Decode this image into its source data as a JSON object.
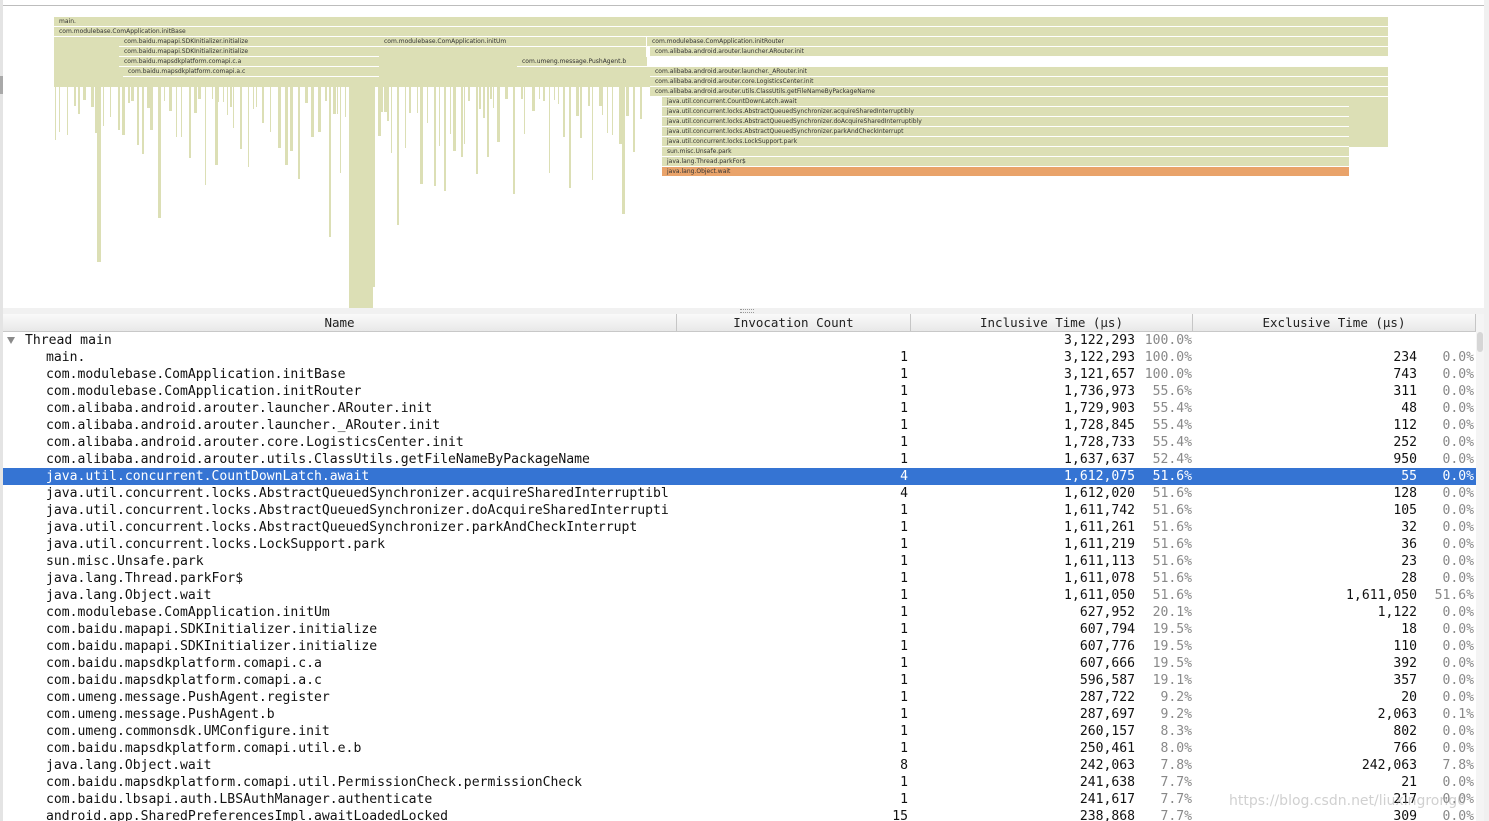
{
  "flame": {
    "bars": [
      {
        "label": "main.",
        "hot": false
      },
      {
        "label": "com.modulebase.ComApplication.initBase",
        "hot": false
      },
      {
        "label": "com.baidu.mapapi.SDKInitializer.initialize",
        "hot": false
      },
      {
        "label": "com.modulebase.ComApplication.initUm",
        "hot": false
      },
      {
        "label": "com.modulebase.ComApplication.initRouter",
        "hot": false
      },
      {
        "label": "com.baidu.mapapi.SDKInitializer.initialize",
        "hot": false
      },
      {
        "label": "com.alibaba.android.arouter.launcher.ARouter.init",
        "hot": false
      },
      {
        "label": "com.baidu.mapsdkplatform.comapi.c.a",
        "hot": false
      },
      {
        "label": "com.umeng.message.PushAgent.b",
        "hot": false
      },
      {
        "label": "com.alibaba.android.arouter.launcher._ARouter.init",
        "hot": false
      },
      {
        "label": "com.baidu.mapsdkplatform.comapi.a.c",
        "hot": false
      },
      {
        "label": "com.alibaba.android.arouter.core.LogisticsCenter.init",
        "hot": false
      },
      {
        "label": "com.alibaba.android.arouter.utils.ClassUtils.getFileNameByPackageName",
        "hot": false
      },
      {
        "label": "java.util.concurrent.CountDownLatch.await",
        "hot": false
      },
      {
        "label": "java.util.concurrent.locks.AbstractQueuedSynchronizer.acquireSharedInterruptibly",
        "hot": false
      },
      {
        "label": "java.util.concurrent.locks.AbstractQueuedSynchronizer.doAcquireSharedInterruptibly",
        "hot": false
      },
      {
        "label": "java.util.concurrent.locks.AbstractQueuedSynchronizer.parkAndCheckInterrupt",
        "hot": false
      },
      {
        "label": "java.util.concurrent.locks.LockSupport.park",
        "hot": false
      },
      {
        "label": "sun.misc.Unsafe.park",
        "hot": false
      },
      {
        "label": "java.lang.Thread.parkFor$",
        "hot": false
      },
      {
        "label": "java.lang.Object.wait",
        "hot": true
      }
    ]
  },
  "table": {
    "headers": {
      "name": "Name",
      "invocation": "Invocation Count",
      "inclusive": "Inclusive Time (µs)",
      "exclusive": "Exclusive Time (µs)"
    },
    "thread_row": {
      "name": "Thread main",
      "inclusive": "3,122,293",
      "inclusive_pct": "100.0%"
    },
    "rows": [
      {
        "name": "main.",
        "count": "1",
        "incl": "3,122,293",
        "inclp": "100.0%",
        "excl": "234",
        "exclp": "0.0%"
      },
      {
        "name": "com.modulebase.ComApplication.initBase",
        "count": "1",
        "incl": "3,121,657",
        "inclp": "100.0%",
        "excl": "743",
        "exclp": "0.0%"
      },
      {
        "name": "com.modulebase.ComApplication.initRouter",
        "count": "1",
        "incl": "1,736,973",
        "inclp": "55.6%",
        "excl": "311",
        "exclp": "0.0%"
      },
      {
        "name": "com.alibaba.android.arouter.launcher.ARouter.init",
        "count": "1",
        "incl": "1,729,903",
        "inclp": "55.4%",
        "excl": "48",
        "exclp": "0.0%"
      },
      {
        "name": "com.alibaba.android.arouter.launcher._ARouter.init",
        "count": "1",
        "incl": "1,728,845",
        "inclp": "55.4%",
        "excl": "112",
        "exclp": "0.0%"
      },
      {
        "name": "com.alibaba.android.arouter.core.LogisticsCenter.init",
        "count": "1",
        "incl": "1,728,733",
        "inclp": "55.4%",
        "excl": "252",
        "exclp": "0.0%"
      },
      {
        "name": "com.alibaba.android.arouter.utils.ClassUtils.getFileNameByPackageName",
        "count": "1",
        "incl": "1,637,637",
        "inclp": "52.4%",
        "excl": "950",
        "exclp": "0.0%"
      },
      {
        "name": "java.util.concurrent.CountDownLatch.await",
        "count": "4",
        "incl": "1,612,075",
        "inclp": "51.6%",
        "excl": "55",
        "exclp": "0.0%",
        "selected": true
      },
      {
        "name": "java.util.concurrent.locks.AbstractQueuedSynchronizer.acquireSharedInterruptibl",
        "count": "4",
        "incl": "1,612,020",
        "inclp": "51.6%",
        "excl": "128",
        "exclp": "0.0%"
      },
      {
        "name": "java.util.concurrent.locks.AbstractQueuedSynchronizer.doAcquireSharedInterrupti",
        "count": "1",
        "incl": "1,611,742",
        "inclp": "51.6%",
        "excl": "105",
        "exclp": "0.0%"
      },
      {
        "name": "java.util.concurrent.locks.AbstractQueuedSynchronizer.parkAndCheckInterrupt",
        "count": "1",
        "incl": "1,611,261",
        "inclp": "51.6%",
        "excl": "32",
        "exclp": "0.0%"
      },
      {
        "name": "java.util.concurrent.locks.LockSupport.park",
        "count": "1",
        "incl": "1,611,219",
        "inclp": "51.6%",
        "excl": "36",
        "exclp": "0.0%"
      },
      {
        "name": "sun.misc.Unsafe.park",
        "count": "1",
        "incl": "1,611,113",
        "inclp": "51.6%",
        "excl": "23",
        "exclp": "0.0%"
      },
      {
        "name": "java.lang.Thread.parkFor$",
        "count": "1",
        "incl": "1,611,078",
        "inclp": "51.6%",
        "excl": "28",
        "exclp": "0.0%"
      },
      {
        "name": "java.lang.Object.wait",
        "count": "1",
        "incl": "1,611,050",
        "inclp": "51.6%",
        "excl": "1,611,050",
        "exclp": "51.6%"
      },
      {
        "name": "com.modulebase.ComApplication.initUm",
        "count": "1",
        "incl": "627,952",
        "inclp": "20.1%",
        "excl": "1,122",
        "exclp": "0.0%"
      },
      {
        "name": "com.baidu.mapapi.SDKInitializer.initialize",
        "count": "1",
        "incl": "607,794",
        "inclp": "19.5%",
        "excl": "18",
        "exclp": "0.0%"
      },
      {
        "name": "com.baidu.mapapi.SDKInitializer.initialize",
        "count": "1",
        "incl": "607,776",
        "inclp": "19.5%",
        "excl": "110",
        "exclp": "0.0%"
      },
      {
        "name": "com.baidu.mapsdkplatform.comapi.c.a",
        "count": "1",
        "incl": "607,666",
        "inclp": "19.5%",
        "excl": "392",
        "exclp": "0.0%"
      },
      {
        "name": "com.baidu.mapsdkplatform.comapi.a.c",
        "count": "1",
        "incl": "596,587",
        "inclp": "19.1%",
        "excl": "357",
        "exclp": "0.0%"
      },
      {
        "name": "com.umeng.message.PushAgent.register",
        "count": "1",
        "incl": "287,722",
        "inclp": "9.2%",
        "excl": "20",
        "exclp": "0.0%"
      },
      {
        "name": "com.umeng.message.PushAgent.b",
        "count": "1",
        "incl": "287,697",
        "inclp": "9.2%",
        "excl": "2,063",
        "exclp": "0.1%"
      },
      {
        "name": "com.umeng.commonsdk.UMConfigure.init",
        "count": "1",
        "incl": "260,157",
        "inclp": "8.3%",
        "excl": "802",
        "exclp": "0.0%"
      },
      {
        "name": "com.baidu.mapsdkplatform.comapi.util.e.b",
        "count": "1",
        "incl": "250,461",
        "inclp": "8.0%",
        "excl": "766",
        "exclp": "0.0%"
      },
      {
        "name": "java.lang.Object.wait",
        "count": "8",
        "incl": "242,063",
        "inclp": "7.8%",
        "excl": "242,063",
        "exclp": "7.8%"
      },
      {
        "name": "com.baidu.mapsdkplatform.comapi.util.PermissionCheck.permissionCheck",
        "count": "1",
        "incl": "241,638",
        "inclp": "7.7%",
        "excl": "21",
        "exclp": "0.0%"
      },
      {
        "name": "com.baidu.lbsapi.auth.LBSAuthManager.authenticate",
        "count": "1",
        "incl": "241,617",
        "inclp": "7.7%",
        "excl": "217",
        "exclp": "0.0%"
      },
      {
        "name": "android.app.SharedPreferencesImpl.awaitLoadedLocked",
        "count": "15",
        "incl": "238,868",
        "inclp": "7.7%",
        "excl": "309",
        "exclp": "0.0%"
      }
    ]
  },
  "watermark": "https://blog.csdn.net/liuxingrong0"
}
